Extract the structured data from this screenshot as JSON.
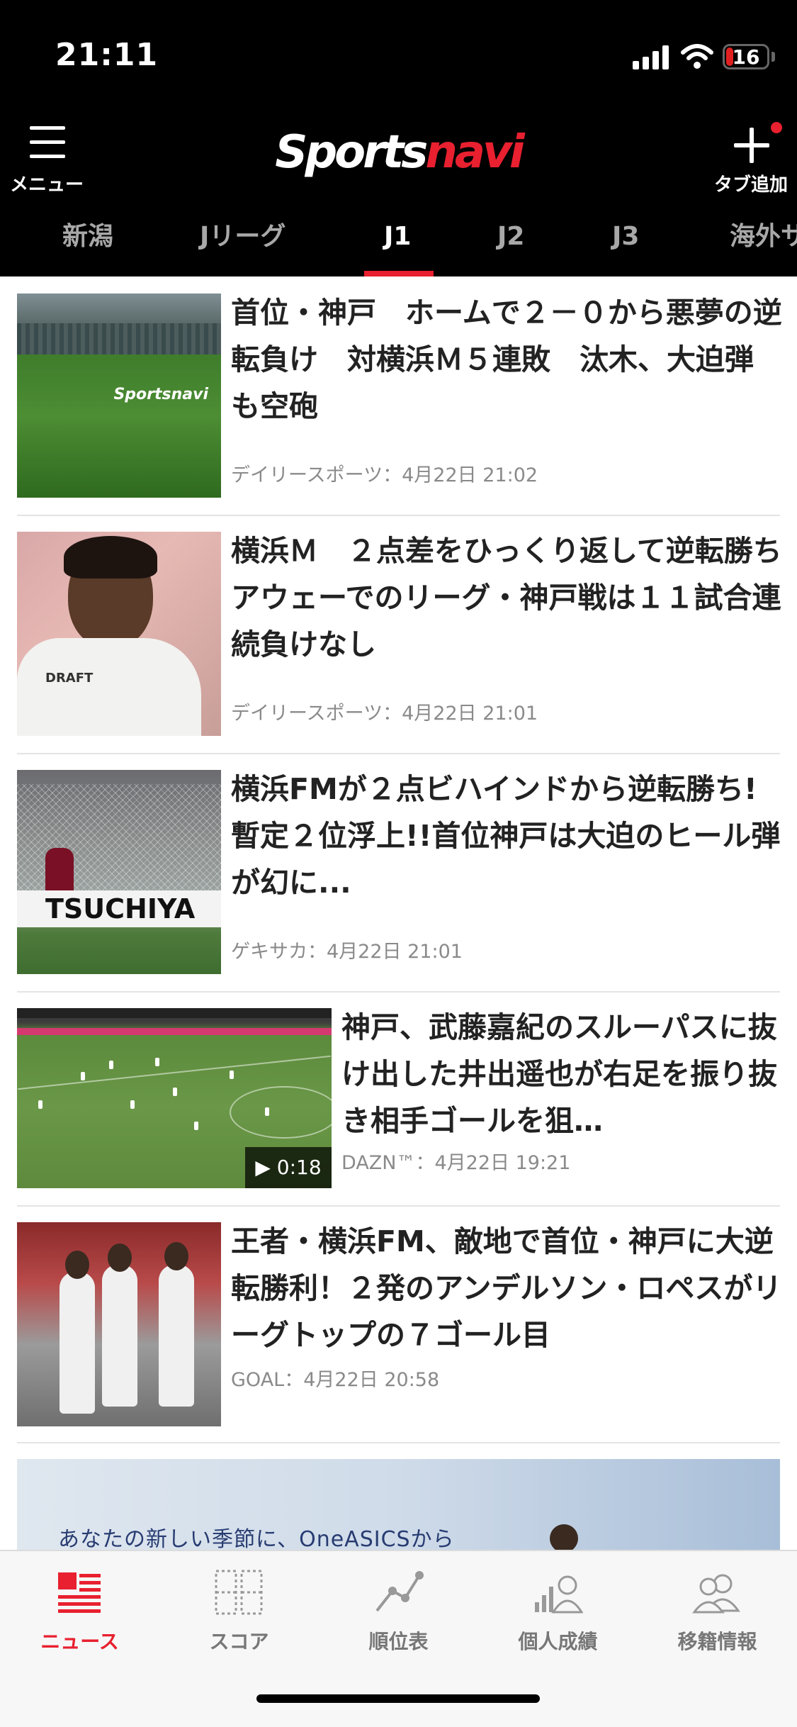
{
  "status": {
    "time": "21:11",
    "battery": "16"
  },
  "header": {
    "logo_a": "Sports",
    "logo_b": "navi",
    "menu_label": "メニュー",
    "add_tab_label": "タブ追加"
  },
  "tabs": [
    {
      "label": "新潟"
    },
    {
      "label": "Jリーグ"
    },
    {
      "label": "J1",
      "active": true
    },
    {
      "label": "J2"
    },
    {
      "label": "J3"
    },
    {
      "label": "海外サ"
    }
  ],
  "articles": [
    {
      "title": "首位・神戸　ホームで２－０から悪夢の逆転負け　対横浜Ｍ５連敗　汰木、大迫弾も空砲",
      "source": "デイリースポーツ",
      "date": "4月22日 21:02"
    },
    {
      "title": "横浜Ｍ　２点差をひっくり返して逆転勝ち　アウェーでのリーグ・神戸戦は１１試合連続負けなし",
      "source": "デイリースポーツ",
      "date": "4月22日 21:01"
    },
    {
      "title": "横浜FMが２点ビハインドから逆転勝ち!暫定２位浮上!!首位神戸は大迫のヒール弾が幻に...",
      "source": "ゲキサカ",
      "date": "4月22日 21:01"
    },
    {
      "title": "神戸、武藤嘉紀のスルーパスに抜け出した井出遥也が右足を振り抜き相手ゴールを狙…",
      "source": "DAZN™",
      "date": "4月22日 19:21",
      "video_duration": "▶ 0:18"
    },
    {
      "title": "王者・横浜FM、敵地で首位・神戸に大逆転勝利！２発のアンデルソン・ロペスがリーグトップの７ゴール目",
      "source": "GOAL",
      "date": "4月22日 20:58"
    }
  ],
  "thumb_text": {
    "watermark": "Sportsnavi",
    "shirt": "DRAFT",
    "board": "TSUCHIYA"
  },
  "ad": {
    "text": "あなたの新しい季節に、OneASICSから"
  },
  "bottom_nav": [
    {
      "label": "ニュース",
      "icon": "news-icon",
      "active": true
    },
    {
      "label": "スコア",
      "icon": "score-icon"
    },
    {
      "label": "順位表",
      "icon": "standings-icon"
    },
    {
      "label": "個人成績",
      "icon": "stats-icon"
    },
    {
      "label": "移籍情報",
      "icon": "transfer-icon"
    }
  ],
  "colors": {
    "accent": "#e8202f",
    "header_bg": "#000000",
    "inactive": "#777777"
  }
}
